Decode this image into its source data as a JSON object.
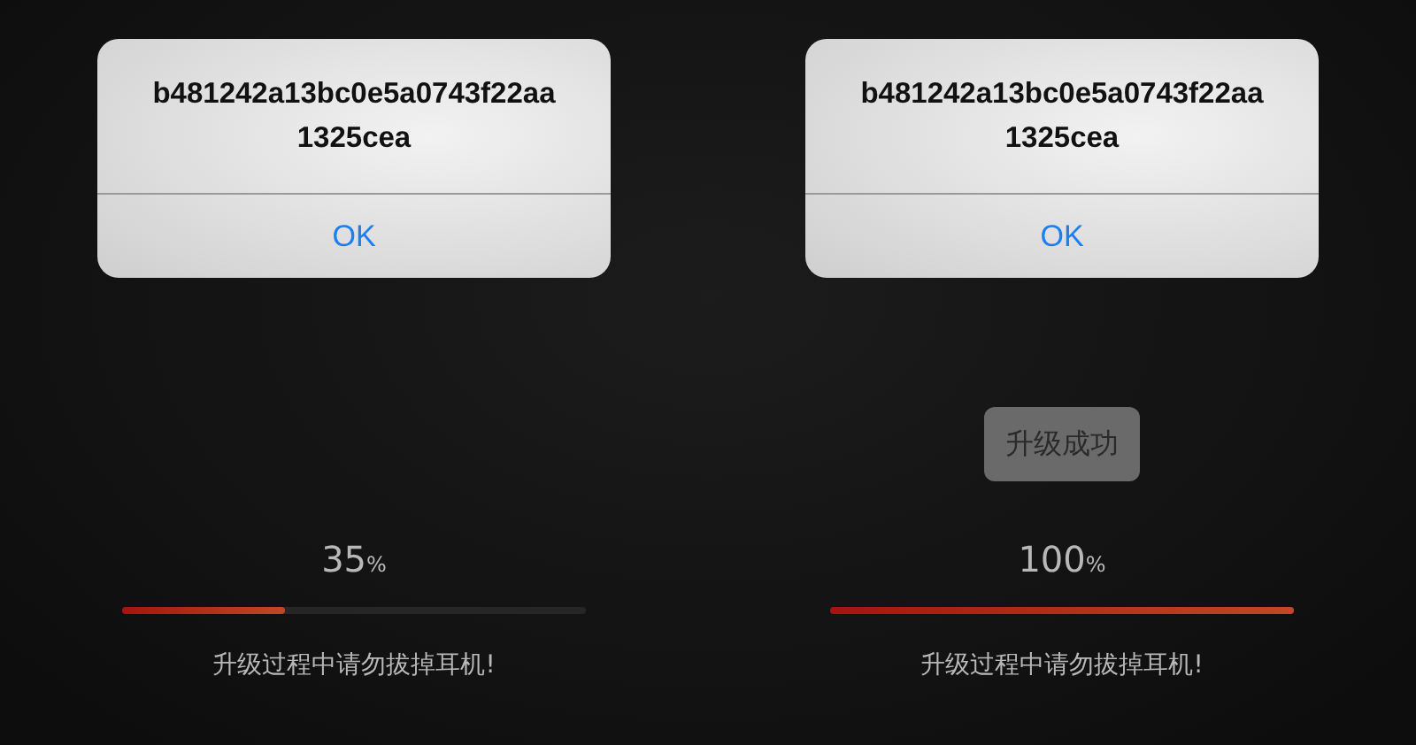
{
  "panels": [
    {
      "alert": {
        "message": "b481242a13bc0e5a0743f22aa1325cea",
        "button": "OK"
      },
      "progress": {
        "value": "35",
        "unit": "%",
        "level": 0.35
      },
      "warning": "升级过程中请勿拔掉耳机!"
    },
    {
      "alert": {
        "message": "b481242a13bc0e5a0743f22aa1325cea",
        "button": "OK"
      },
      "toast": "升级成功",
      "progress": {
        "value": "100",
        "unit": "%",
        "level": 1.0
      },
      "warning": "升级过程中请勿拔掉耳机!"
    }
  ]
}
